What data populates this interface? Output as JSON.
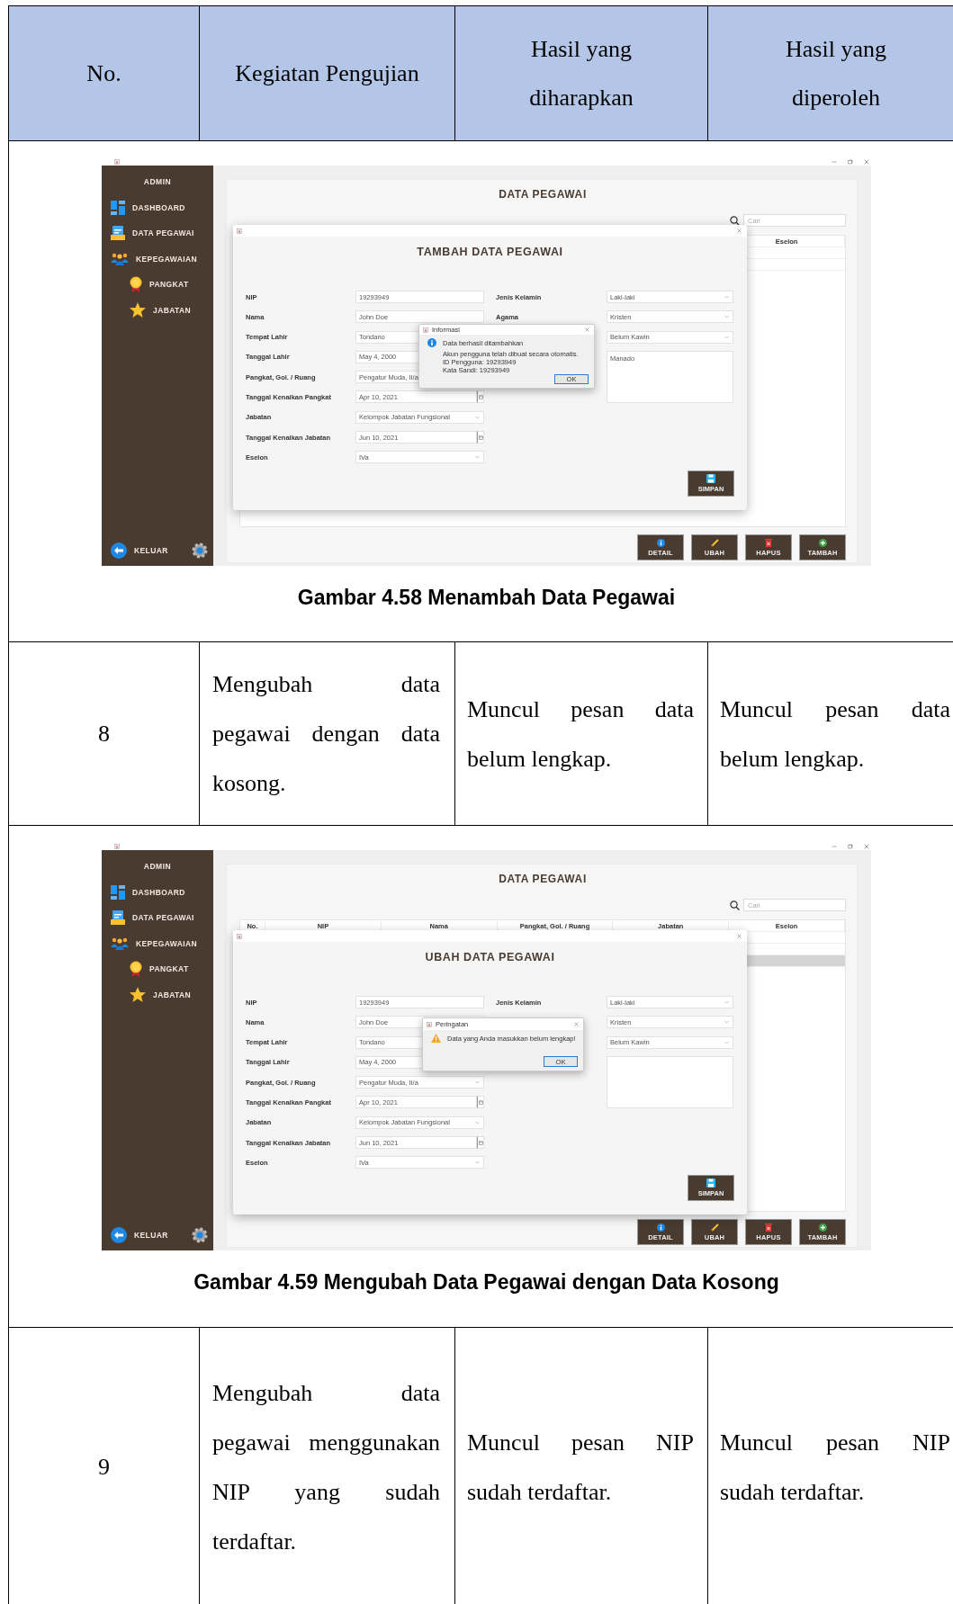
{
  "table": {
    "columns": [
      "No.",
      "Kegiatan Pengujian",
      "Hasil yang diharapkan",
      "Hasil yang diperoleh"
    ],
    "rows": [
      {
        "kind": "figure",
        "caption": "Gambar 4.58 Menambah Data Pegawai",
        "screenshot": {
          "sidebar": {
            "title": "ADMIN",
            "items": [
              {
                "label": "DASHBOARD"
              },
              {
                "label": "DATA PEGAWAI"
              },
              {
                "label": "KEPEGAWAIAN",
                "children": [
                  {
                    "label": "PANGKAT"
                  },
                  {
                    "label": "JABATAN"
                  }
                ]
              }
            ],
            "footer_button": "KELUAR"
          },
          "page_title": "DATA PEGAWAI",
          "search": {
            "placeholder": "Cari"
          },
          "data_table": {
            "columns": [
              "Eselon"
            ],
            "rows": [
              {
                "selected": false
              },
              {
                "selected": false
              }
            ]
          },
          "actions": [
            "DETAIL",
            "UBAH",
            "HAPUS",
            "TAMBAH"
          ],
          "dialog": {
            "title": "TAMBAH DATA PEGAWAI",
            "left_fields": [
              {
                "label": "NIP",
                "value": "19293949",
                "kind": "text"
              },
              {
                "label": "Nama",
                "value": "John Doe",
                "kind": "text"
              },
              {
                "label": "Tempat Lahir",
                "value": "Tondano",
                "kind": "text"
              },
              {
                "label": "Tanggal Lahir",
                "value": "May 4, 2000",
                "kind": "text"
              },
              {
                "label": "Pangkat, Gol. / Ruang",
                "value": "Pengatur Muda, II/a",
                "kind": "select"
              },
              {
                "label": "Tanggal Kenaikan Pangkat",
                "value": "Apr 10, 2021",
                "kind": "date"
              },
              {
                "label": "Jabatan",
                "value": "Kelompok Jabatan Fungsional",
                "kind": "select"
              },
              {
                "label": "Tanggal Kenaikan Jabatan",
                "value": "Jun 10, 2021",
                "kind": "date"
              },
              {
                "label": "Eselon",
                "value": "IVa",
                "kind": "select"
              }
            ],
            "right_fields": [
              {
                "label": "Jenis Kelamin",
                "value": "Laki-laki",
                "kind": "select"
              },
              {
                "label": "Agama",
                "value": "Kristen",
                "kind": "select"
              },
              {
                "value": "Belum Kawin",
                "kind": "select"
              },
              {
                "value": "Manado",
                "kind": "textarea"
              }
            ],
            "save_button": "SIMPAN"
          },
          "message": {
            "kind": "info",
            "title": "Informasi",
            "lines": [
              "Data berhasil ditambahkan",
              "Akun pengguna telah dibuat secara otomatis.",
              "ID Pengguna: 19293949",
              "Kata Sandi: 19293949"
            ],
            "button": "OK"
          }
        }
      },
      {
        "kind": "test",
        "no": "8",
        "activity": "Mengubah data pegawai dengan data kosong.",
        "expected": "Muncul pesan data belum lengkap.",
        "actual": "Muncul pesan data belum lengkap."
      },
      {
        "kind": "figure",
        "caption": "Gambar 4.59 Mengubah Data Pegawai dengan Data Kosong",
        "screenshot": {
          "sidebar": {
            "title": "ADMIN",
            "items": [
              {
                "label": "DASHBOARD"
              },
              {
                "label": "DATA PEGAWAI"
              },
              {
                "label": "KEPEGAWAIAN",
                "children": [
                  {
                    "label": "PANGKAT"
                  },
                  {
                    "label": "JABATAN"
                  }
                ]
              }
            ],
            "footer_button": "KELUAR"
          },
          "page_title": "DATA PEGAWAI",
          "search": {
            "placeholder": "Cari"
          },
          "data_table": {
            "columns": [
              "No.",
              "NIP",
              "Nama",
              "Pangkat, Gol. / Ruang",
              "Jabatan",
              "Eselon"
            ],
            "rows": [
              {
                "selected": false
              },
              {
                "selected": false
              },
              {
                "selected": true
              }
            ]
          },
          "actions": [
            "DETAIL",
            "UBAH",
            "HAPUS",
            "TAMBAH"
          ],
          "dialog": {
            "title": "UBAH DATA PEGAWAI",
            "left_fields": [
              {
                "label": "NIP",
                "value": "19293949",
                "kind": "text"
              },
              {
                "label": "Nama",
                "value": "John Doe",
                "kind": "text"
              },
              {
                "label": "Tempat Lahir",
                "value": "Tondano",
                "kind": "text"
              },
              {
                "label": "Tanggal Lahir",
                "value": "May 4, 2000",
                "kind": "text"
              },
              {
                "label": "Pangkat, Gol. / Ruang",
                "value": "Pengatur Muda, II/a",
                "kind": "select"
              },
              {
                "label": "Tanggal Kenaikan Pangkat",
                "value": "Apr 10, 2021",
                "kind": "date"
              },
              {
                "label": "Jabatan",
                "value": "Kelompok Jabatan Fungsional",
                "kind": "select"
              },
              {
                "label": "Tanggal Kenaikan Jabatan",
                "value": "Jun 10, 2021",
                "kind": "date"
              },
              {
                "label": "Eselon",
                "value": "IVa",
                "kind": "select"
              }
            ],
            "right_fields": [
              {
                "label": "Jenis Kelamin",
                "value": "Laki-laki",
                "kind": "select"
              },
              {
                "value": "Kristen",
                "kind": "select"
              },
              {
                "value": "Belum Kawin",
                "kind": "select"
              },
              {
                "kind": "textarea"
              }
            ],
            "save_button": "SIMPAN"
          },
          "message": {
            "kind": "warning",
            "title": "Peringatan",
            "lines": [
              "Data yang Anda masukkan belum lengkap!"
            ],
            "button": "OK"
          }
        }
      },
      {
        "kind": "test",
        "no": "9",
        "activity": "Mengubah data pegawai menggunakan NIP yang sudah terdaftar.",
        "expected": "Muncul pesan NIP sudah terdaftar.",
        "actual": "Muncul pesan NIP sudah terdaftar."
      }
    ]
  }
}
